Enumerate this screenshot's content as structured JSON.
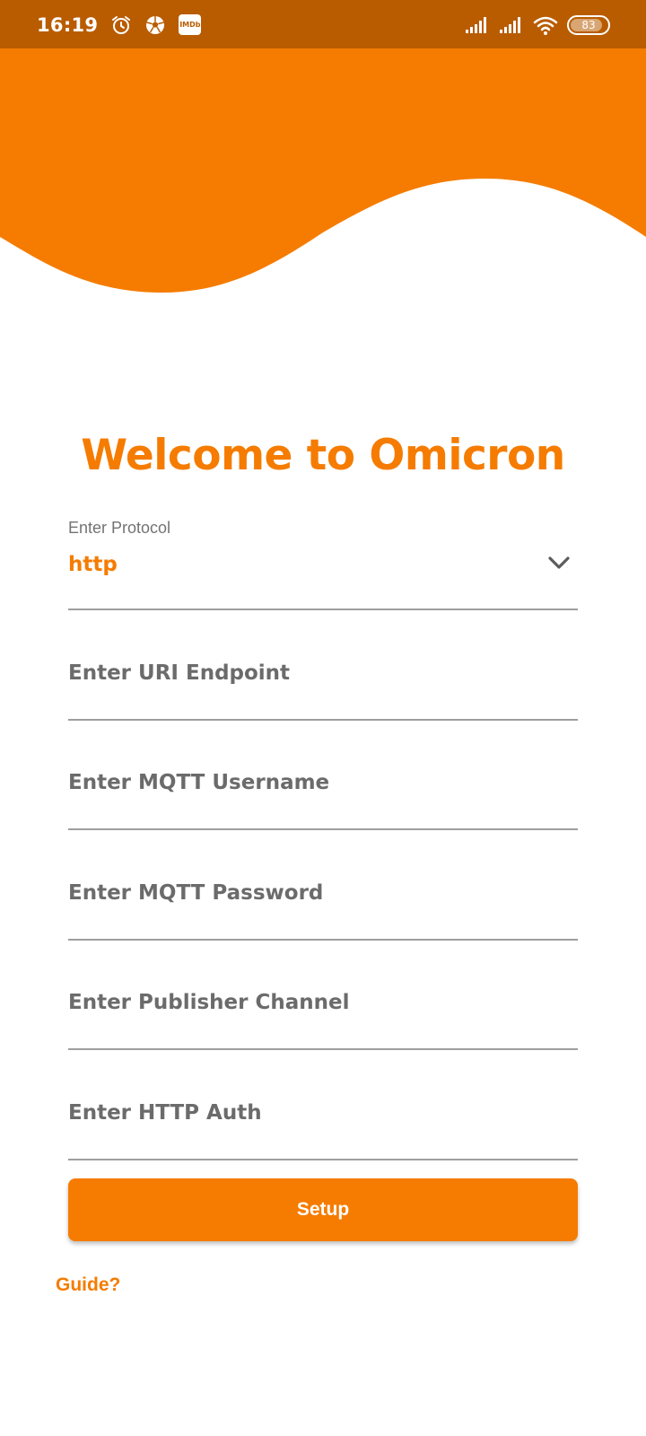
{
  "status_bar": {
    "time": "16:19",
    "battery": "83",
    "icons": [
      "alarm-icon",
      "soccer-ball-icon",
      "imdb-icon",
      "signal-icon",
      "signal-icon",
      "wifi-icon",
      "battery-icon"
    ],
    "imdb_text": "IMDb"
  },
  "colors": {
    "accent": "#f57c00",
    "status_bar": "#b95c00",
    "placeholder": "#6b6b6b",
    "underline": "#9e9e9e"
  },
  "welcome": {
    "title": "Welcome to Omicron"
  },
  "form": {
    "protocol": {
      "label": "Enter Protocol",
      "selected": "http",
      "icon": "chevron-down-icon"
    },
    "uri_endpoint": {
      "placeholder": "Enter URI Endpoint"
    },
    "mqtt_username": {
      "placeholder": "Enter MQTT Username"
    },
    "mqtt_password": {
      "placeholder": "Enter MQTT Password"
    },
    "publisher_channel": {
      "placeholder": "Enter Publisher Channel"
    },
    "http_auth": {
      "placeholder": "Enter HTTP Auth"
    }
  },
  "actions": {
    "setup_label": "Setup",
    "guide_label": "Guide?"
  }
}
